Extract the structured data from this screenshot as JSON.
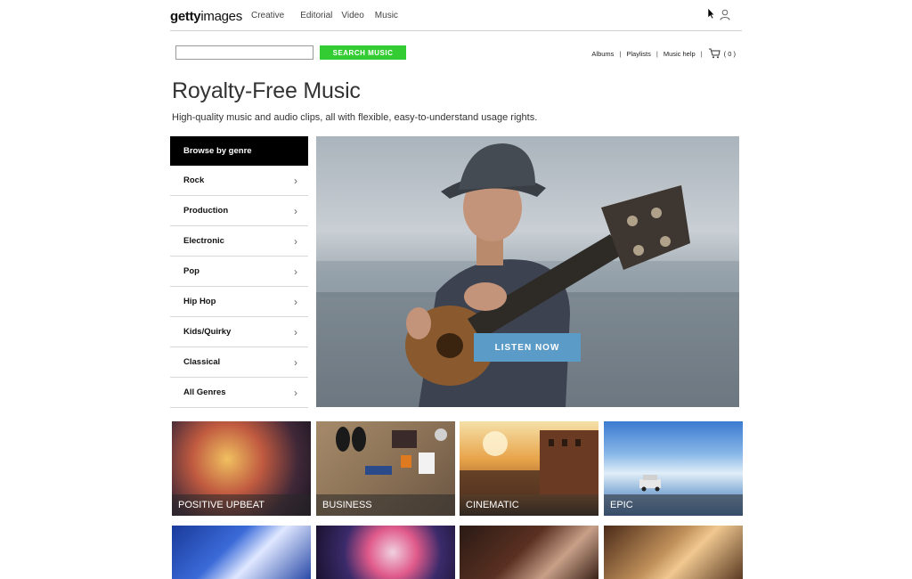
{
  "header": {
    "logo_bold": "getty",
    "logo_rest": "images",
    "nav": [
      "Creative",
      "Editorial",
      "Video",
      "Music"
    ]
  },
  "search": {
    "value": "",
    "placeholder": "",
    "button_label": "SEARCH MUSIC"
  },
  "utility": {
    "albums": "Albums",
    "playlists": "Playlists",
    "help": "Music help",
    "sep": "|",
    "cart_count": "( 0 )"
  },
  "page": {
    "title": "Royalty-Free Music",
    "subtitle": "High-quality music and audio clips, all with flexible, easy-to-understand usage rights."
  },
  "genres": {
    "heading": "Browse by genre",
    "items": [
      "Rock",
      "Production",
      "Electronic",
      "Pop",
      "Hip Hop",
      "Kids/Quirky",
      "Classical",
      "All Genres"
    ]
  },
  "hero": {
    "button_label": "LISTEN NOW"
  },
  "tiles": [
    {
      "label": "POSITIVE UPBEAT"
    },
    {
      "label": "BUSINESS"
    },
    {
      "label": "CINEMATIC"
    },
    {
      "label": "EPIC"
    }
  ],
  "colors": {
    "search_button": "#33cc33",
    "listen_button": "#5b9bc8",
    "genre_header": "#000000"
  }
}
